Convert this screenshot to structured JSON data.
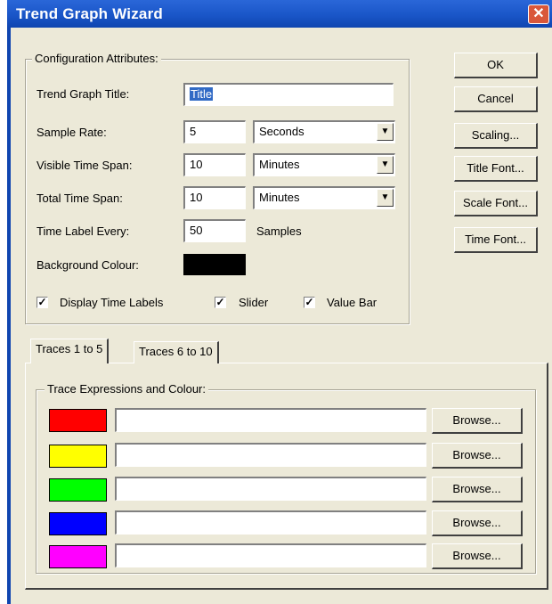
{
  "window": {
    "title": "Trend Graph Wizard",
    "close_glyph": "✕"
  },
  "config": {
    "legend": "Configuration Attributes:",
    "title_label": "Trend Graph Title:",
    "title_value": "Title",
    "sample_rate_label": "Sample Rate:",
    "sample_rate_value": "5",
    "sample_rate_unit": "Seconds",
    "visible_span_label": "Visible Time Span:",
    "visible_span_value": "10",
    "visible_span_unit": "Minutes",
    "total_span_label": "Total Time Span:",
    "total_span_value": "10",
    "total_span_unit": "Minutes",
    "time_label_every_label": "Time Label Every:",
    "time_label_every_value": "50",
    "time_label_every_unit": "Samples",
    "background_colour_label": "Background Colour:",
    "background_colour": "#000000",
    "checkboxes": [
      {
        "label": "Display Time Labels",
        "checked": true
      },
      {
        "label": "Slider",
        "checked": true
      },
      {
        "label": "Value Bar",
        "checked": true
      }
    ],
    "check_glyph": "✓",
    "dropdown_glyph": "▼"
  },
  "buttons": {
    "ok": "OK",
    "cancel": "Cancel",
    "scaling": "Scaling...",
    "title_font": "Title Font...",
    "scale_font": "Scale Font...",
    "time_font": "Time Font..."
  },
  "tabs": [
    {
      "label": "Traces 1 to 5",
      "active": true
    },
    {
      "label": "Traces 6 to 10",
      "active": false
    }
  ],
  "traces": {
    "legend": "Trace Expressions and Colour:",
    "rows": [
      {
        "colour": "#ff0000",
        "expression": "",
        "browse_label": "Browse..."
      },
      {
        "colour": "#ffff00",
        "expression": "",
        "browse_label": "Browse..."
      },
      {
        "colour": "#00ff00",
        "expression": "",
        "browse_label": "Browse..."
      },
      {
        "colour": "#0000ff",
        "expression": "",
        "browse_label": "Browse..."
      },
      {
        "colour": "#ff00ff",
        "expression": "",
        "browse_label": "Browse..."
      }
    ]
  }
}
